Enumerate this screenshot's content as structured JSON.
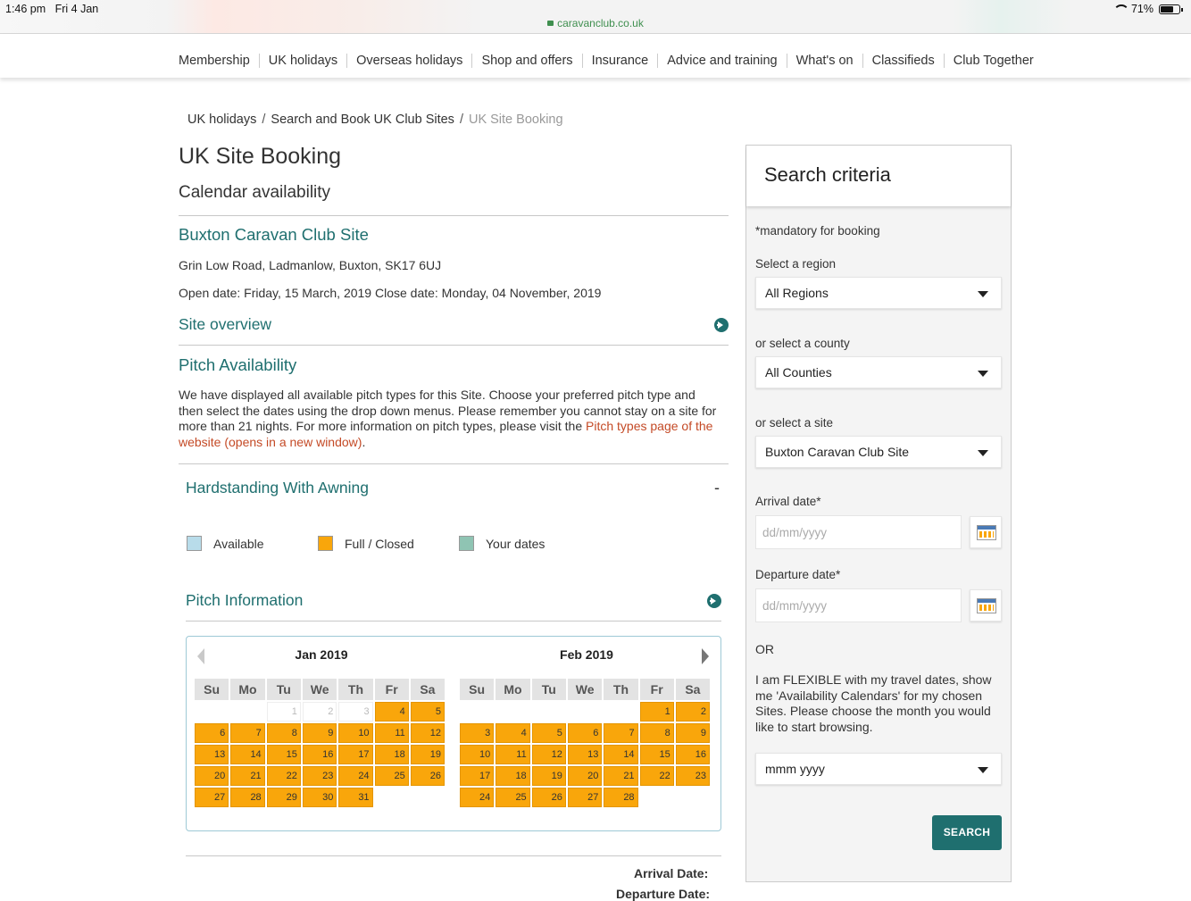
{
  "status": {
    "time": "1:46 pm",
    "date": "Fri 4 Jan",
    "url": "caravanclub.co.uk",
    "battery": "71%"
  },
  "nav": [
    "Membership",
    "UK holidays",
    "Overseas holidays",
    "Shop and offers",
    "Insurance",
    "Advice and training",
    "What's on",
    "Classifieds",
    "Club Together"
  ],
  "breadcrumb": {
    "item1": "UK holidays",
    "item2": "Search and Book UK Club Sites",
    "current": "UK Site Booking",
    "sep": "/"
  },
  "page": {
    "title": "UK Site Booking",
    "subtitle": "Calendar availability",
    "site_name": "Buxton Caravan Club Site",
    "address": "Grin Low Road, Ladmanlow, Buxton, SK17 6UJ",
    "dates": "Open date: Friday, 15 March, 2019 Close date: Monday, 04 November, 2019",
    "site_overview": "Site overview",
    "pitch_availability": "Pitch Availability",
    "pitch_text": "We have displayed all available pitch types for this Site. Choose your preferred pitch type and then select the dates using the drop down menus. Please remember you cannot stay on a site for more than 21 nights. For more information on pitch types, please visit the ",
    "pitch_link": "Pitch types page of the website (opens in a new window)",
    "pitch_text_end": ".",
    "pitch_type": "Hardstanding With Awning",
    "toggle": "-",
    "pitch_information": "Pitch Information",
    "arrival_label": "Arrival Date:",
    "departure_label": "Departure Date:"
  },
  "legend": [
    {
      "label": "Available",
      "color": "#b8dcea"
    },
    {
      "label": "Full / Closed",
      "color": "#f9a60b"
    },
    {
      "label": "Your dates",
      "color": "#8fc4b3"
    }
  ],
  "calendar": {
    "days": [
      "Su",
      "Mo",
      "Tu",
      "We",
      "Th",
      "Fr",
      "Sa"
    ],
    "months": [
      {
        "title": "Jan 2019",
        "weeks": [
          [
            null,
            null,
            "p1",
            "p2",
            "p3",
            "4",
            "5"
          ],
          [
            "6",
            "7",
            "8",
            "9",
            "10",
            "11",
            "12"
          ],
          [
            "13",
            "14",
            "15",
            "16",
            "17",
            "18",
            "19"
          ],
          [
            "20",
            "21",
            "22",
            "23",
            "24",
            "25",
            "26"
          ],
          [
            "27",
            "28",
            "29",
            "30",
            "31",
            null,
            null
          ]
        ]
      },
      {
        "title": "Feb 2019",
        "weeks": [
          [
            null,
            null,
            null,
            null,
            null,
            "1",
            "2"
          ],
          [
            "3",
            "4",
            "5",
            "6",
            "7",
            "8",
            "9"
          ],
          [
            "10",
            "11",
            "12",
            "13",
            "14",
            "15",
            "16"
          ],
          [
            "17",
            "18",
            "19",
            "20",
            "21",
            "22",
            "23"
          ],
          [
            "24",
            "25",
            "26",
            "27",
            "28",
            null,
            null
          ]
        ]
      }
    ]
  },
  "sidebar": {
    "title": "Search criteria",
    "mandatory": "*mandatory for booking",
    "region_label": "Select a region",
    "region_value": "All Regions",
    "county_label": "or select a county",
    "county_value": "All Counties",
    "site_label": "or select a site",
    "site_value": "Buxton Caravan Club Site",
    "arrival_label": "Arrival date*",
    "arrival_placeholder": "dd/mm/yyyy",
    "departure_label": "Departure date*",
    "departure_placeholder": "dd/mm/yyyy",
    "or": "OR",
    "flexible_text": "I am FLEXIBLE with my travel dates, show me 'Availability Calendars' for my chosen Sites. Please choose the month you would like to start browsing.",
    "month_value": "mmm yyyy",
    "search_button": "SEARCH"
  }
}
